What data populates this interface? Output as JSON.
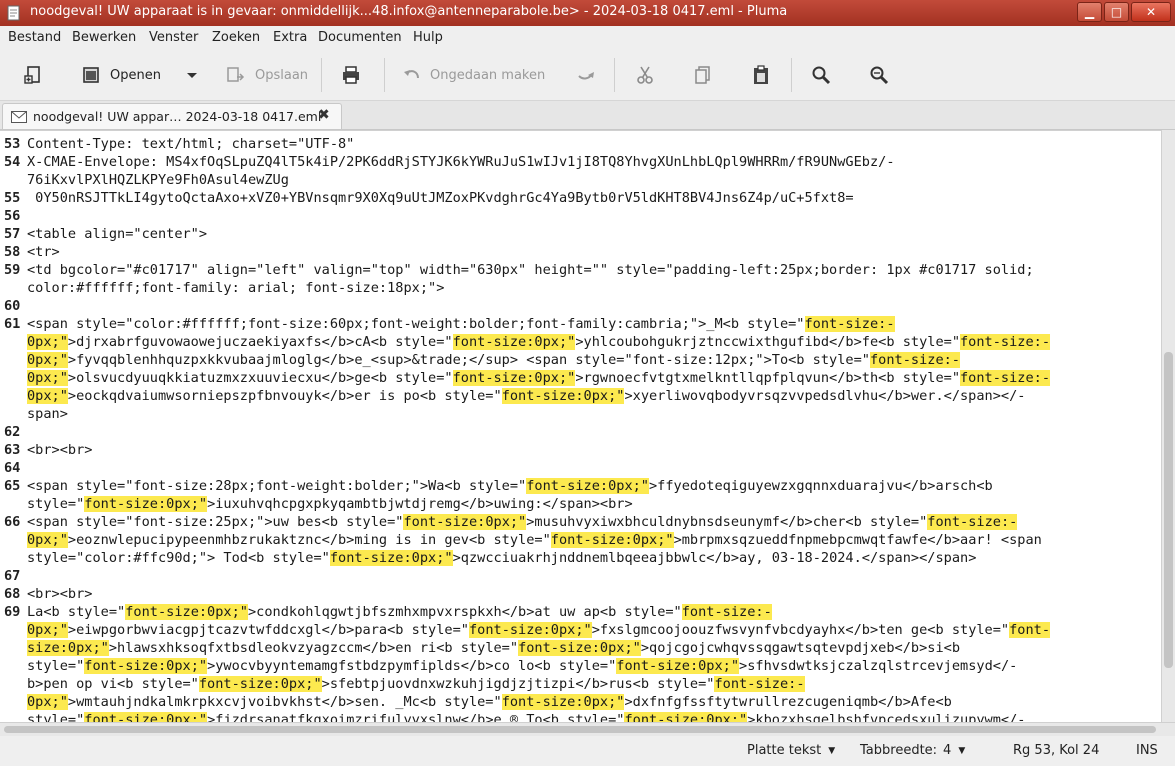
{
  "window": {
    "title": "noodgeval! UW apparaat is in gevaar: onmiddellijk...48.infox@antenneparabole.be> - 2024-03-18 0417.eml - Pluma",
    "minimize": "▁",
    "maximize": "□",
    "close": "✕"
  },
  "menubar": {
    "items": [
      "Bestand",
      "Bewerken",
      "Venster",
      "Zoeken",
      "Extra",
      "Documenten",
      "Hulp"
    ]
  },
  "toolbar": {
    "open_label": "Openen",
    "save_label": "Opslaan",
    "undo_label": "Ongedaan maken"
  },
  "tab": {
    "label": "noodgeval! UW appar… 2024-03-18 0417.eml",
    "close": "✖"
  },
  "editor": {
    "lines": [
      {
        "n": "53",
        "t": "Content-Type: text/html; charset=\"UTF-8\""
      },
      {
        "n": "54",
        "t": "X-CMAE-Envelope: MS4xfOqSLpuZQ4lT5k4iP/2PK6ddRjSTYJK6kYWRuJuS1wIJv1jI8TQ8YhvgXUnLhbLQpl9WHRRm/fR9UNwGEbz/-"
      },
      {
        "n": "",
        "t": "76iKxvlPXlHQZLKPYe9Fh0Asul4ewZUg"
      },
      {
        "n": "55",
        "t": " 0Y50nRSJTTkLI4gytoQctaAxo+xVZ0+YBVnsqmr9X0Xq9uUtJMZoxPKvdghrGc4Ya9Bytb0rV5ldKHT8BV4Jns6Z4p/uC+5fxt8="
      },
      {
        "n": "56",
        "t": ""
      },
      {
        "n": "57",
        "t": "<table align=\"center\">"
      },
      {
        "n": "58",
        "t": "<tr>"
      },
      {
        "n": "59",
        "t": "<td bgcolor=\"#c01717\" align=\"left\" valign=\"top\" width=\"630px\" height=\"\" style=\"padding-left:25px;border: 1px #c01717 solid;"
      },
      {
        "n": "",
        "t": "color:#ffffff;font-family: arial; font-size:18px;\">"
      },
      {
        "n": "60",
        "t": ""
      },
      {
        "n": "61",
        "t": "<span style=\"color:#ffffff;font-size:60px;font-weight:bolder;font-family:cambria;\">_M<b style=\"[[font-size:-]]"
      },
      {
        "n": "",
        "t": "[[0px;\"]]>djrxabrfguvowaowejuczaekiyaxfs</b>cA<b style=\"[[font-size:0px;\"]]>yhlcoubohgukrjztnccwixthgufibd</b>fe<b style=\"[[font-size:-]]"
      },
      {
        "n": "",
        "t": "[[0px;\"]]>fyvqqblenhhquzpxkkvubaajmloglg</b>e_<sup>&trade;</sup> <span style=\"font-size:12px;\">To<b style=\"[[font-size:-]]"
      },
      {
        "n": "",
        "t": "[[0px;\"]]>olsvucdyuuqkkiatuzmxzxuuviecxu</b>ge<b style=\"[[font-size:0px;\"]]>rgwnoecfvtgtxmelkntllqpfplqvun</b>th<b style=\"[[font-size:-]]"
      },
      {
        "n": "",
        "t": "[[0px;\"]]>eockqdvaiumwsorniepszpfbnvouyk</b>er is po<b style=\"[[font-size:0px;\"]]>xyerliwovqbodyvrsqzvvpedsdlvhu</b>wer.</span></-"
      },
      {
        "n": "",
        "t": "span>"
      },
      {
        "n": "62",
        "t": ""
      },
      {
        "n": "63",
        "t": "<br><br>"
      },
      {
        "n": "64",
        "t": ""
      },
      {
        "n": "65",
        "t": "<span style=\"font-size:28px;font-weight:bolder;\">Wa<b style=\"[[font-size:0px;\"]]>ffyedoteqiguyewzxgqnnxduarajvu</b>arsch<b"
      },
      {
        "n": "",
        "t": "style=\"[[font-size:0px;\"]]>iuxuhvqhcpgxpkyqambtbjwtdjremg</b>uwing:</span><br>"
      },
      {
        "n": "66",
        "t": "<span style=\"font-size:25px;\">uw bes<b style=\"[[font-size:0px;\"]]>musuhvyxiwxbhculdnybnsdseunymf</b>cher<b style=\"[[font-size:-]]"
      },
      {
        "n": "",
        "t": "[[0px;\"]]>eoznwlepucipypeenmhbzrukaktznc</b>ming is in gev<b style=\"[[font-size:0px;\"]]>mbrpmxsqzueddfnpmebpcmwqtfawfe</b>aar! <span"
      },
      {
        "n": "",
        "t": "style=\"color:#ffc90d;\"> Tod<b style=\"[[font-size:0px;\"]]>qzwcciuakrhjnddnemlbqeeajbbwlc</b>ay, 03-18-2024.</span></span>"
      },
      {
        "n": "67",
        "t": ""
      },
      {
        "n": "68",
        "t": "<br><br>"
      },
      {
        "n": "69",
        "t": "La<b style=\"[[font-size:0px;\"]]>condkohlqgwtjbfszmhxmpvxrspkxh</b>at uw ap<b style=\"[[font-size:-]]"
      },
      {
        "n": "",
        "t": "[[0px;\"]]>eiwpgorbwviacgpjtcazvtwfddcxgl</b>para<b style=\"[[font-size:0px;\"]]>fxslgmcoojoouzfwsvynfvbcdyayhx</b>ten ge<b style=\"[[font-]]"
      },
      {
        "n": "",
        "t": "[[size:0px;\"]]>hlawsxhksoqfxtbsdleokvzyagzccm</b>en ri<b style=\"[[font-size:0px;\"]]>qojcgojcwhqvssqgawtsqtevpdjxeb</b>si<b"
      },
      {
        "n": "",
        "t": "style=\"[[font-size:0px;\"]]>ywocvbyyntemamgfstbdzpymfiplds</b>co lo<b style=\"[[font-size:0px;\"]]>sfhvsdwtksjczalzqlstrcevjemsyd</-"
      },
      {
        "n": "",
        "t": "b>pen op vi<b style=\"[[font-size:0px;\"]]>sfebtpjuovdnxwzkuhjigdjzjtizpi</b>rus<b style=\"[[font-size:-]]"
      },
      {
        "n": "",
        "t": "[[0px;\"]]>wmtauhjndkalmkrpkxcvjvoibvkhst</b>sen. _Mc<b style=\"[[font-size:0px;\"]]>dxfnfgfssftytwrullrezcugeniqmb</b>Afe<b"
      },
      {
        "n": "",
        "t": "style=\"[[font-size:0px;\"]]>fjzdrsanatfkgxoimzrifulyyxslnw</b>e_® To<b style=\"[[font-size:0px;\"]]>kbozxhsgelbshfvpcedsxulizupywm</-"
      }
    ]
  },
  "statusbar": {
    "language": "Platte tekst",
    "tab_width_label": "Tabbreedte:",
    "tab_width_value": "4",
    "position": "Rg 53, Kol 24",
    "mode": "INS"
  },
  "colors": {
    "titlebar": "#b53a2a",
    "highlight": "#fce94f"
  }
}
